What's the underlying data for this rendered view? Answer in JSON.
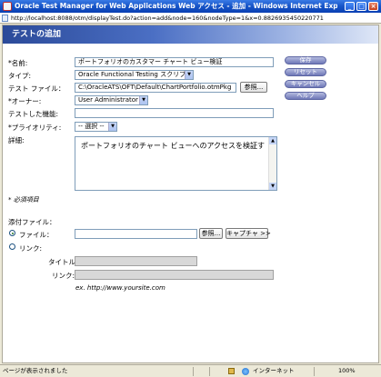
{
  "window": {
    "title": "Oracle Test Manager for Web Applications Web アクセス - 追加 - Windows Internet Explorer",
    "url": "http://localhost:8088/otm/displayTest.do?action=add&node=160&nodeType=1&x=0.8826935450220771"
  },
  "page": {
    "title": "テストの追加"
  },
  "form": {
    "name_label": "*名前:",
    "name_value": "ポートフォリオのカスタマー チャート ビュー検証",
    "type_label": "タイプ:",
    "type_value": "Oracle Functional Testing スクリプト",
    "testfile_label": "テスト ファイル：",
    "testfile_value": "C:\\OracleATS\\OFT\\Default\\ChartPortfolio.otmPkg",
    "browse_label": "参照...",
    "owner_label": "*オーナー:",
    "owner_value": "User Administrator",
    "feature_label": "テストした機能:",
    "feature_value": "",
    "priority_label": "*プライオリティ:",
    "priority_value": "-- 選択 --",
    "detail_label": "詳細:",
    "detail_value": "ポートフォリオのチャート ビューへのアクセスを検証す",
    "required_note": "* 必須項目"
  },
  "actions": {
    "save": "保存",
    "reset": "リセット",
    "cancel": "キャンセル",
    "help": "ヘルプ"
  },
  "attachment": {
    "section_label": "添付ファイル：",
    "file_label": "ファイル：",
    "file_value": "",
    "browse_label": "参照...",
    "capture_label": "キャプチャ >>",
    "link_label": "リンク:",
    "link_title_label": "タイトル：",
    "link_title_value": "",
    "link_url_label": "リンク:",
    "link_url_value": "",
    "example": "ex.  http://www.yoursite.com",
    "selected_option": "file"
  },
  "statusbar": {
    "status": "ページが表示されました",
    "zone": "インターネット",
    "zoom": "100%"
  }
}
